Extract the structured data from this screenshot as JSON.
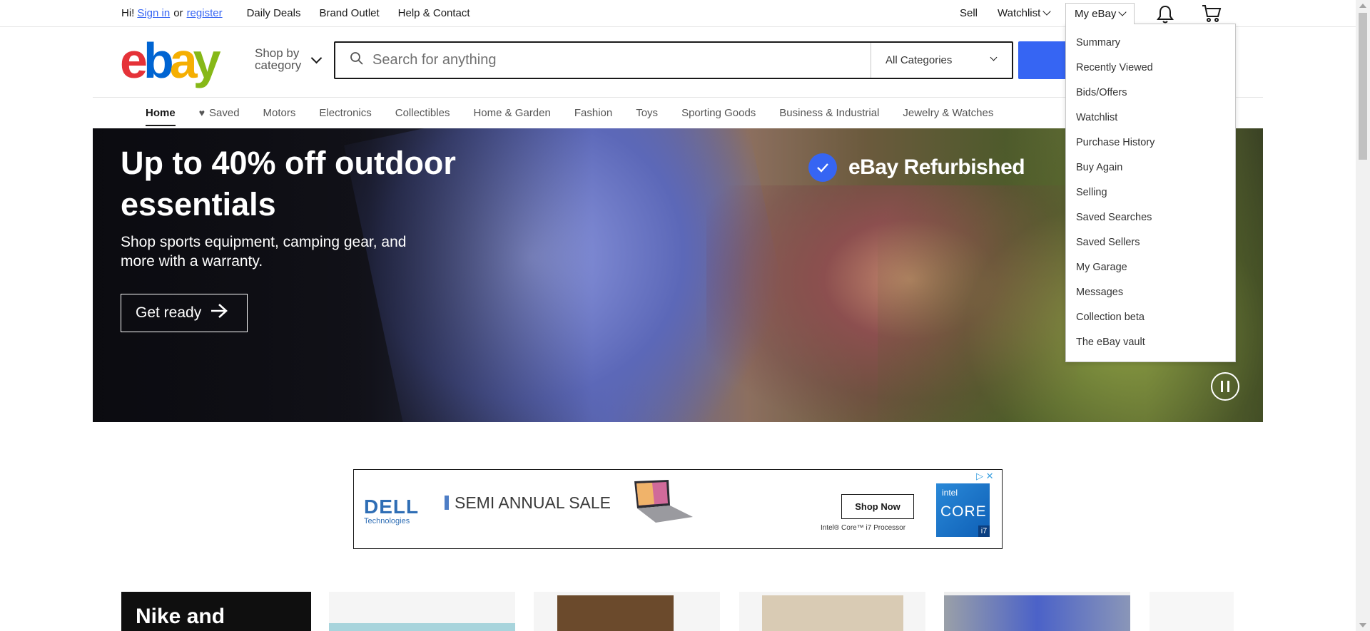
{
  "topbar": {
    "greeting": "Hi!",
    "sign_in": "Sign in",
    "or": "or",
    "register": "register",
    "links": [
      "Daily Deals",
      "Brand Outlet",
      "Help & Contact"
    ],
    "sell": "Sell",
    "watchlist": "Watchlist",
    "my_ebay": "My eBay"
  },
  "header": {
    "logo": {
      "e": "e",
      "b": "b",
      "a": "a",
      "y": "y"
    },
    "shop_by_category_line1": "Shop by",
    "shop_by_category_line2": "category",
    "search_placeholder": "Search for anything",
    "category_selected": "All Categories"
  },
  "nav": {
    "items": [
      "Home",
      "Saved",
      "Motors",
      "Electronics",
      "Collectibles",
      "Home & Garden",
      "Fashion",
      "Toys",
      "Sporting Goods",
      "Business & Industrial",
      "Jewelry & Watches"
    ]
  },
  "hero": {
    "headline": "Up to 40% off outdoor essentials",
    "subtext": "Shop sports equipment, camping gear, and more with a warranty.",
    "cta": "Get ready",
    "badge": "eBay Refurbished"
  },
  "ad": {
    "brand": "DELL",
    "brand_sub": "Technologies",
    "headline": "SEMI ANNUAL SALE",
    "button": "Shop Now",
    "processor_note": "Intel® Core™ i7 Processor",
    "intel_label": "intel",
    "intel_core": "CORE",
    "intel_tier": "i7"
  },
  "cards": {
    "first_title": "Nike and"
  },
  "my_ebay_menu": {
    "items": [
      "Summary",
      "Recently Viewed",
      "Bids/Offers",
      "Watchlist",
      "Purchase History",
      "Buy Again",
      "Selling",
      "Saved Searches",
      "Saved Sellers",
      "My Garage",
      "Messages",
      "Collection beta",
      "The eBay vault"
    ]
  },
  "colors": {
    "accent": "#3665f3",
    "logo_e": "#e53238",
    "logo_b": "#0064d2",
    "logo_a": "#f5af02",
    "logo_y": "#86b817"
  }
}
